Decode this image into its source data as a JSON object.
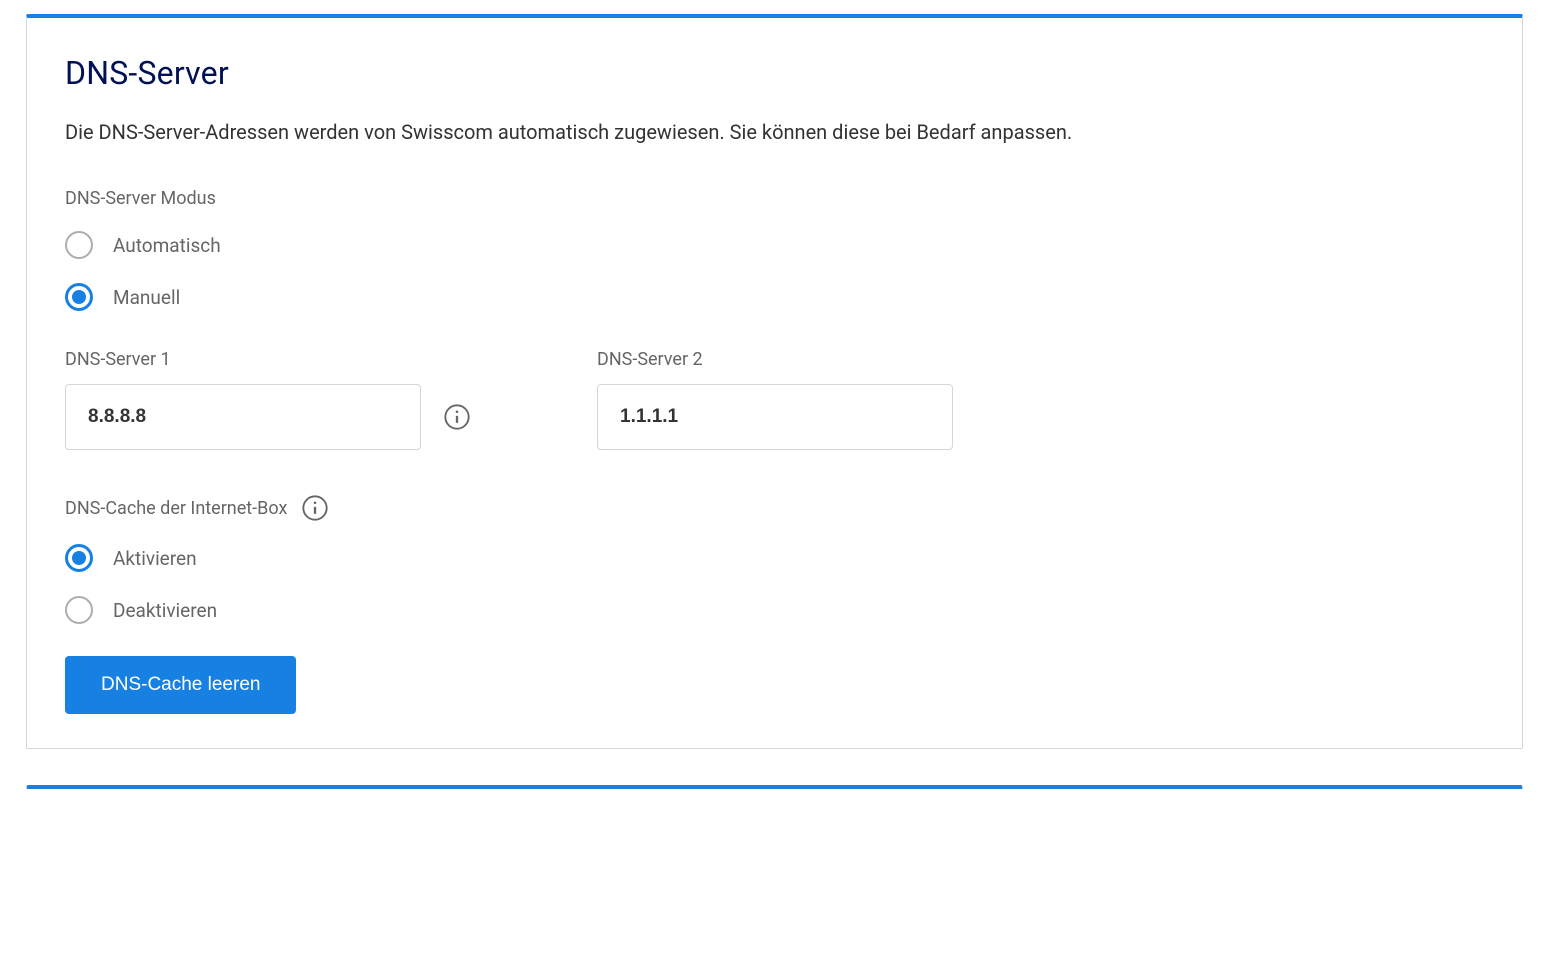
{
  "title": "DNS-Server",
  "description": "Die DNS-Server-Adressen werden von Swisscom automatisch zugewiesen. Sie können diese bei Bedarf anpassen.",
  "mode": {
    "label": "DNS-Server Modus",
    "options": {
      "auto": "Automatisch",
      "manual": "Manuell"
    },
    "selected": "manual"
  },
  "server1": {
    "label": "DNS-Server 1",
    "value": "8.8.8.8"
  },
  "server2": {
    "label": "DNS-Server 2",
    "value": "1.1.1.1"
  },
  "cache": {
    "label": "DNS-Cache der Internet-Box",
    "options": {
      "enable": "Aktivieren",
      "disable": "Deaktivieren"
    },
    "selected": "enable",
    "clear_button": "DNS-Cache leeren"
  }
}
